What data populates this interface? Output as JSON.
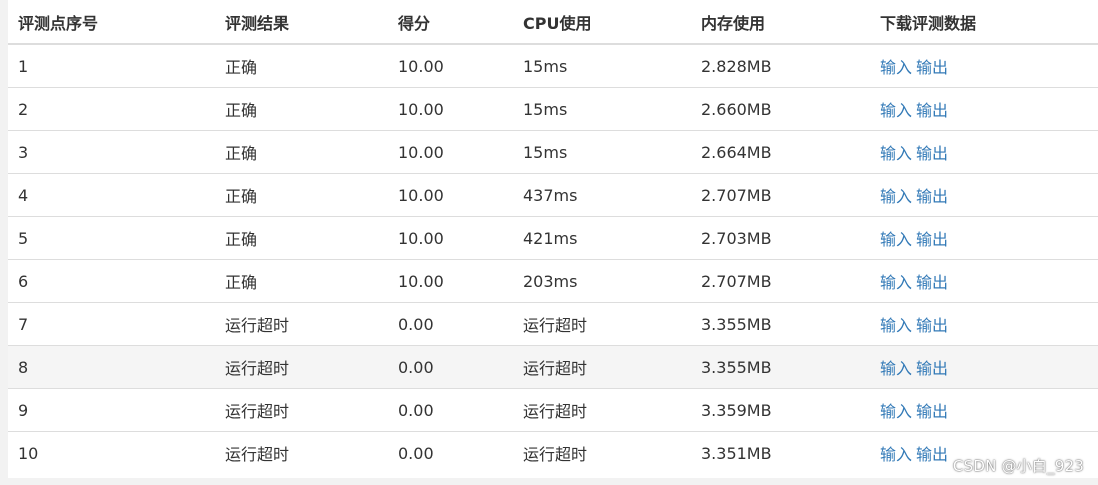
{
  "table": {
    "headers": [
      "评测点序号",
      "评测结果",
      "得分",
      "CPU使用",
      "内存使用",
      "下载评测数据"
    ],
    "rows": [
      {
        "id": "1",
        "result": "正确",
        "score": "10.00",
        "cpu": "15ms",
        "mem": "2.828MB"
      },
      {
        "id": "2",
        "result": "正确",
        "score": "10.00",
        "cpu": "15ms",
        "mem": "2.660MB"
      },
      {
        "id": "3",
        "result": "正确",
        "score": "10.00",
        "cpu": "15ms",
        "mem": "2.664MB"
      },
      {
        "id": "4",
        "result": "正确",
        "score": "10.00",
        "cpu": "437ms",
        "mem": "2.707MB"
      },
      {
        "id": "5",
        "result": "正确",
        "score": "10.00",
        "cpu": "421ms",
        "mem": "2.703MB"
      },
      {
        "id": "6",
        "result": "正确",
        "score": "10.00",
        "cpu": "203ms",
        "mem": "2.707MB"
      },
      {
        "id": "7",
        "result": "运行超时",
        "score": "0.00",
        "cpu": "运行超时",
        "mem": "3.355MB"
      },
      {
        "id": "8",
        "result": "运行超时",
        "score": "0.00",
        "cpu": "运行超时",
        "mem": "3.355MB"
      },
      {
        "id": "9",
        "result": "运行超时",
        "score": "0.00",
        "cpu": "运行超时",
        "mem": "3.359MB"
      },
      {
        "id": "10",
        "result": "运行超时",
        "score": "0.00",
        "cpu": "运行超时",
        "mem": "3.351MB"
      }
    ],
    "links": {
      "input": "输入",
      "output": "输出"
    },
    "hovered_row": "8"
  },
  "watermark": "CSDN @小白_923",
  "colors": {
    "link": "#337ab7",
    "border": "#dddddd",
    "hover_row": "#f5f5f5",
    "text": "#333333"
  }
}
